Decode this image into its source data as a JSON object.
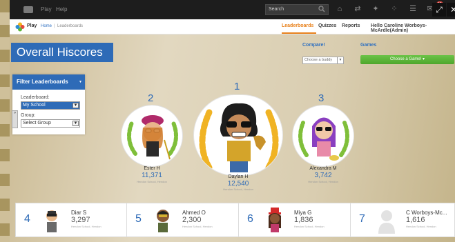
{
  "topbar": {
    "play": "Play",
    "help": "Help",
    "search_placeholder": "Search",
    "notification_count": "10"
  },
  "header": {
    "app_name": "Play",
    "breadcrumb_home": "Home",
    "breadcrumb_sep": "|",
    "breadcrumb_current": "Leaderboards",
    "menu": [
      "Leaderboards",
      "Quizzes",
      "Reports"
    ],
    "greeting": "Hello Caroline Worboys-McArdle(Admin)"
  },
  "title": "Overall Hiscores",
  "compare": {
    "label": "Compare!",
    "select_value": "Choose a buddy"
  },
  "games": {
    "label": "Games",
    "button": "Choose a Game! ▾"
  },
  "filter": {
    "heading": "Filter Leaderboards",
    "leaderboard_label": "Leaderboard:",
    "leaderboard_value": "My School",
    "group_label": "Group:",
    "group_value": "Select Group"
  },
  "podium": [
    {
      "rank": "2",
      "name": "Ester H",
      "score": "11,371",
      "school": "Hendon School, Hendon"
    },
    {
      "rank": "1",
      "name": "Daylan H",
      "score": "12,540",
      "school": "Hendon School, Hendon"
    },
    {
      "rank": "3",
      "name": "Alexandra M",
      "score": "3,742",
      "school": "Hendon School, Hendon"
    }
  ],
  "cards": [
    {
      "rank": "4",
      "name": "Diar S",
      "score": "3,297",
      "school": "Hendon School, Hendon"
    },
    {
      "rank": "5",
      "name": "Ahmed O",
      "score": "2,300",
      "school": "Hendon School, Hendon"
    },
    {
      "rank": "6",
      "name": "Miya G",
      "score": "1,836",
      "school": "Hendon School, Hendon"
    },
    {
      "rank": "7",
      "name": "C Worboys-Mc...",
      "score": "1,616",
      "school": "Hendon School, Hendon"
    }
  ],
  "colors": {
    "brand_blue": "#2e6bb7",
    "accent_orange": "#e8801a",
    "games_green": "#5bb53a",
    "topbar_dark": "#1d1d1d"
  }
}
